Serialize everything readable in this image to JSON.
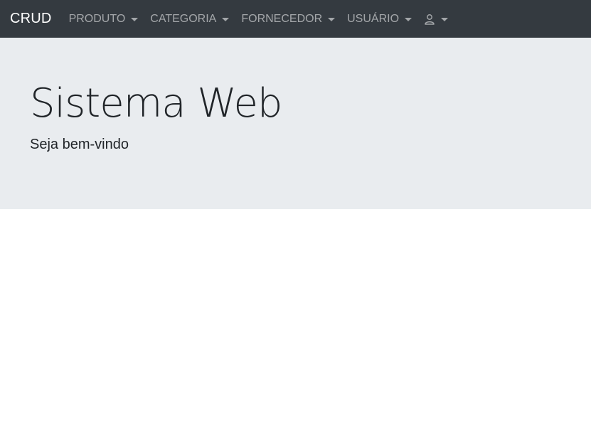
{
  "navbar": {
    "brand": "CRUD",
    "items": [
      {
        "label": "PRODUTO"
      },
      {
        "label": "CATEGORIA"
      },
      {
        "label": "FORNECEDOR"
      },
      {
        "label": "USUÁRIO"
      }
    ],
    "user_menu_icon": "user-icon"
  },
  "jumbotron": {
    "title": "Sistema Web",
    "subtitle": "Seja bem-vindo"
  },
  "colors": {
    "navbar_bg": "#343a40",
    "jumbotron_bg": "#e9ecef",
    "text": "#212529"
  }
}
